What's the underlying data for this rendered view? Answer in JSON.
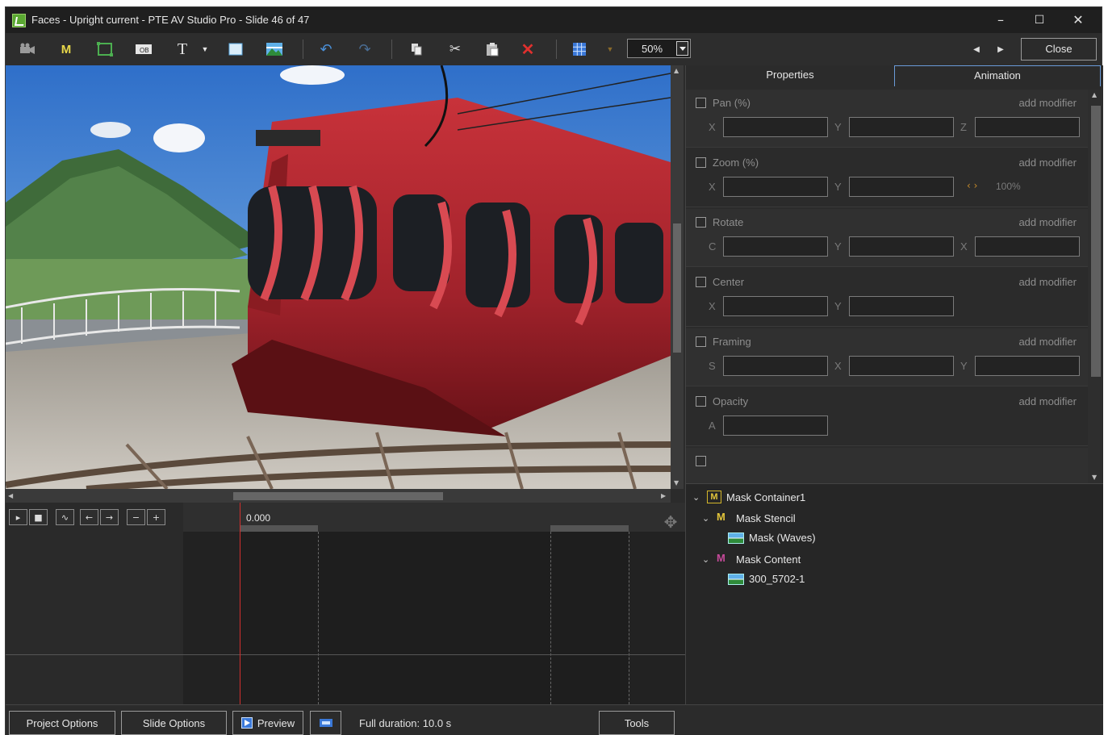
{
  "window": {
    "title": "Faces - Upright current - PTE AV Studio Pro - Slide 46 of 47",
    "minimize": "–",
    "maximize": "☐",
    "close": "✕"
  },
  "toolbar": {
    "icons": [
      "camera-icon",
      "mask-m-icon",
      "frame-icon",
      "text-frame-icon",
      "text-icon",
      "rectangle-icon",
      "image-icon",
      "undo-icon",
      "redo-icon",
      "copy-icon",
      "cut-icon",
      "paste-icon",
      "delete-icon",
      "grid-icon",
      "grid-dropdown-icon"
    ],
    "zoom": "50%",
    "close_label": "Close",
    "colors": {
      "mask_m": "#e8d84a",
      "delete": "#e0302e",
      "undo": "#4a90d9"
    }
  },
  "tabs": {
    "properties": "Properties",
    "animation": "Animation"
  },
  "properties": {
    "add_modifier": "add modifier",
    "items": [
      {
        "label": "Pan (%)",
        "axes": [
          "X",
          "Y",
          "Z"
        ]
      },
      {
        "label": "Zoom (%)",
        "axes": [
          "X",
          "Y"
        ],
        "extra": "100%"
      },
      {
        "label": "Rotate",
        "axes": [
          "C",
          "Y",
          "X"
        ]
      },
      {
        "label": "Center",
        "axes": [
          "X",
          "Y"
        ]
      },
      {
        "label": "Framing",
        "axes": [
          "S",
          "X",
          "Y"
        ]
      },
      {
        "label": "Opacity",
        "axes": [
          "A"
        ]
      }
    ]
  },
  "tree": {
    "nodes": [
      {
        "label": "Mask Container1",
        "type": "container"
      },
      {
        "label": "Mask Stencil",
        "type": "stencil"
      },
      {
        "label": "Mask (Waves)",
        "type": "image"
      },
      {
        "label": "Mask Content",
        "type": "content"
      },
      {
        "label": "300_5702-1",
        "type": "image"
      }
    ]
  },
  "timeline": {
    "time": "0.000",
    "controls": [
      "▸",
      "■",
      "∿",
      "←",
      "→",
      "−",
      "+"
    ]
  },
  "bottom": {
    "project_options": "Project Options",
    "slide_options": "Slide Options",
    "preview": "Preview",
    "duration": "Full duration: 10.0 s",
    "tools": "Tools"
  }
}
